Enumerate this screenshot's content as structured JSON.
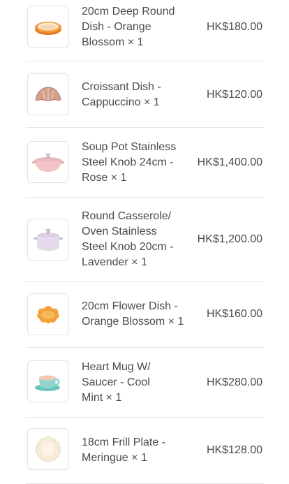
{
  "order_items": [
    {
      "name": "20cm Deep Round\nDish - Orange\nBlossom × 1",
      "price": "HK$180.00",
      "image_icon": "deep-round-dish-icon"
    },
    {
      "name": "Croissant Dish -\nCappuccino × 1",
      "price": "HK$120.00",
      "image_icon": "croissant-dish-icon"
    },
    {
      "name": "Soup Pot Stainless\nSteel Knob 24cm -\nRose × 1",
      "price": "HK$1,400.00",
      "image_icon": "soup-pot-icon"
    },
    {
      "name": "Round Casserole/\nOven Stainless\nSteel Knob 20cm -\nLavender × 1",
      "price": "HK$1,200.00",
      "image_icon": "round-casserole-icon"
    },
    {
      "name": "20cm Flower Dish -\nOrange Blossom × 1",
      "price": "HK$160.00",
      "image_icon": "flower-dish-icon"
    },
    {
      "name": "Heart Mug W/\nSaucer - Cool\nMint × 1",
      "price": "HK$280.00",
      "image_icon": "heart-mug-icon"
    },
    {
      "name": "18cm Frill Plate -\nMeringue × 1",
      "price": "HK$128.00",
      "image_icon": "frill-plate-icon"
    }
  ]
}
